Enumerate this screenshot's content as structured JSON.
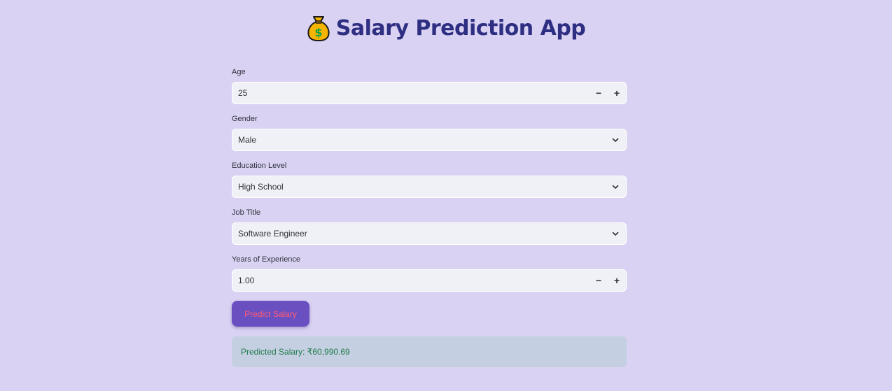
{
  "app": {
    "title": "Salary Prediction App",
    "icon": "money-bag-icon"
  },
  "form": {
    "age": {
      "label": "Age",
      "value": "25"
    },
    "gender": {
      "label": "Gender",
      "value": "Male"
    },
    "education": {
      "label": "Education Level",
      "value": "High School"
    },
    "job_title": {
      "label": "Job Title",
      "value": "Software Engineer"
    },
    "experience": {
      "label": "Years of Experience",
      "value": "1.00"
    },
    "decrement_symbol": "−",
    "increment_symbol": "+"
  },
  "actions": {
    "predict_label": "Predict Salary"
  },
  "result": {
    "text": "Predicted Salary: ₹60,990.69"
  },
  "colors": {
    "background": "#d9d2f2",
    "title": "#2e2e82",
    "button": "#6a4fc1",
    "button_text": "#ff5c73",
    "result_bg": "#c4cfe2",
    "result_text": "#1f7a4a"
  }
}
